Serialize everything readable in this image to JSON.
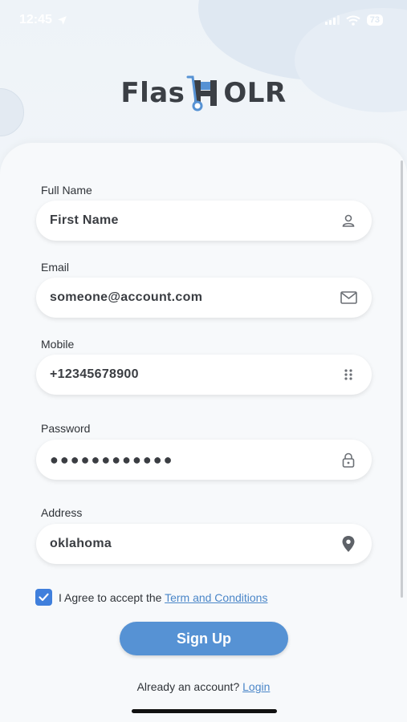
{
  "status_bar": {
    "time": "12:45",
    "battery": "73"
  },
  "app": {
    "logo_prefix": "Flas",
    "logo_suffix": "OLR"
  },
  "form": {
    "full_name": {
      "label": "Full Name",
      "value": "First Name",
      "icon": "person-icon"
    },
    "email": {
      "label": "Email",
      "value": "someone@account.com",
      "icon": "mail-icon"
    },
    "mobile": {
      "label": "Mobile",
      "value": "+12345678900",
      "icon": "keypad-icon"
    },
    "password": {
      "label": "Password",
      "value": "●●●●●●●●●●●●",
      "icon": "lock-icon"
    },
    "address": {
      "label": "Address",
      "value": "oklahoma",
      "icon": "location-pin-icon"
    }
  },
  "agree": {
    "checked": true,
    "text": "I Agree to accept the",
    "link": "Term and Conditions"
  },
  "signup_label": "Sign Up",
  "footer": {
    "text": "Already an account?",
    "link": "Login"
  },
  "colors": {
    "accent": "#5692d4",
    "checkbox": "#3f7fdc",
    "link": "#4a86c8"
  }
}
